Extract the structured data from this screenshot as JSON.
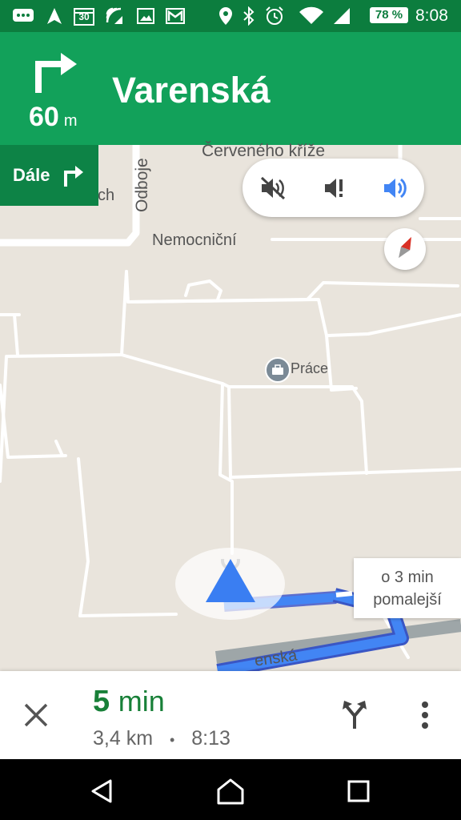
{
  "status_bar": {
    "calendar_day": "30",
    "battery": "78 %",
    "time": "8:08",
    "icons": [
      "message-icon",
      "navigation-icon",
      "calendar-icon",
      "wifi-call-icon",
      "image-icon",
      "gmail-icon",
      "location-icon",
      "bluetooth-icon",
      "alarm-icon",
      "wifi-icon",
      "signal-icon",
      "battery-icon"
    ]
  },
  "navigation": {
    "distance": "60",
    "distance_unit": "m",
    "street": "Varenská",
    "then_label": "Dále",
    "maneuver_icon": "turn-right-icon"
  },
  "map": {
    "street_labels": [
      "Červeného kříže",
      "Odboje",
      "ch",
      "Nemocniční",
      "enská"
    ],
    "poi_label": "Práce",
    "alt_route_line1": "o 3 min",
    "alt_route_line2": "pomalejší",
    "sound_options": [
      "mute-icon",
      "alerts-only-icon",
      "unmute-icon"
    ],
    "sound_selected": "unmute-icon",
    "colors": {
      "route": "#4285f4",
      "header": "#12a15a",
      "eta": "#188038"
    }
  },
  "bottom": {
    "eta_value": "5",
    "eta_unit": "min",
    "distance": "3,4 km",
    "separator": "•",
    "arrival": "8:13"
  }
}
